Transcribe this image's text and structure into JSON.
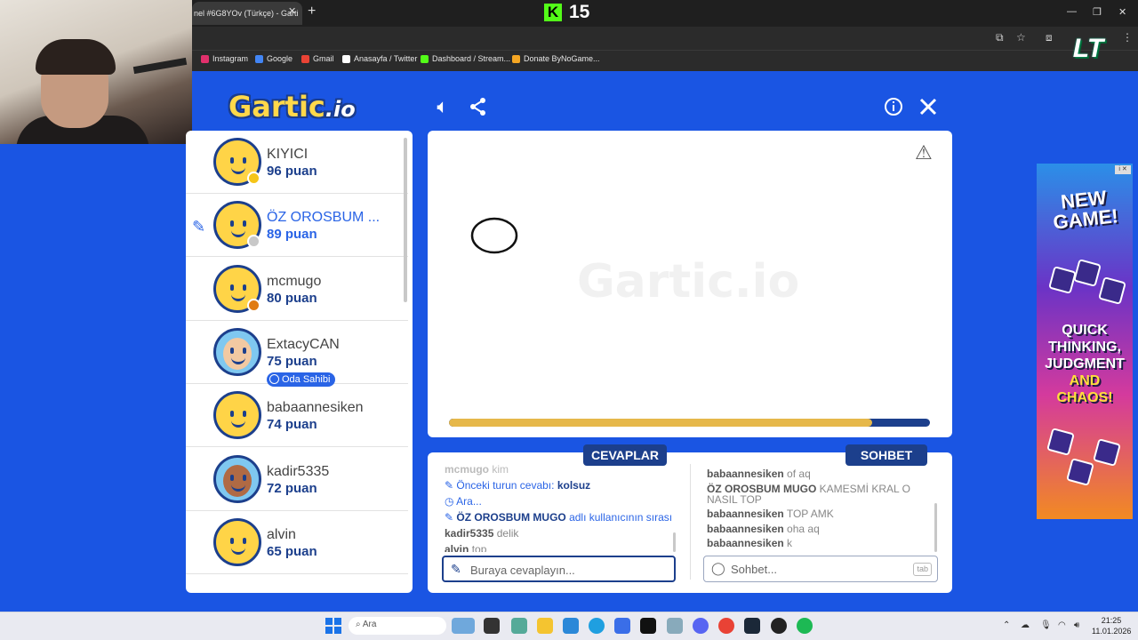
{
  "browser": {
    "tab_title": "nel #6G8YOv (Türkçe) - Garti",
    "tab_close": "✕",
    "new_tab": "+",
    "viewer_count": "15",
    "kick_letter": "K",
    "bookmarks": [
      {
        "label": "Instagram",
        "color": "#e1306c"
      },
      {
        "label": "Google",
        "color": "#4285f4"
      },
      {
        "label": "Gmail",
        "color": "#ea4335"
      },
      {
        "label": "Anasayfa / Twitter",
        "color": "#ffffff"
      },
      {
        "label": "Dashboard / Stream...",
        "color": "#53fc18"
      },
      {
        "label": "Donate ByNoGame...",
        "color": "#f5a623"
      }
    ],
    "overlay_logo": "LT"
  },
  "game": {
    "logo_main": "Gartic",
    "logo_suffix": ".io",
    "watermark_main": "Gartic",
    "watermark_suffix": ".io",
    "colors": {
      "background": "#1a55e3",
      "navy": "#1c3f8c",
      "accent": "#2a64e6",
      "timer": "#e6b84a"
    },
    "timer_remaining": 0.88,
    "players": [
      {
        "name": "KIYICI",
        "score": "96 puan",
        "status_color": "#f5c518",
        "active": false
      },
      {
        "name": "ÖZ OROSBUM ...",
        "score": "89 puan",
        "status_color": "#c8c8c8",
        "active": true
      },
      {
        "name": "mcmugo",
        "score": "80 puan",
        "status_color": "#e07b12",
        "active": false
      },
      {
        "name": "ExtacyCAN",
        "score": "75 puan",
        "badge": "Oda Sahibi",
        "active": false
      },
      {
        "name": "babaannesiken",
        "score": "74 puan",
        "active": false
      },
      {
        "name": "kadir5335",
        "score": "72 puan",
        "active": false
      },
      {
        "name": "alvin",
        "score": "65 puan",
        "active": false
      }
    ],
    "answers_tab": "CEVAPLAR",
    "chat_tab": "SOHBET",
    "answers_feed": {
      "faded_user": "mcmugo",
      "faded_msg": "kim",
      "prev_answer_label": "Önceki turun cevabı:",
      "prev_answer_value": "kolsuz",
      "search_msg": "Ara...",
      "turn_user": "ÖZ OROSBUM MUGO",
      "turn_msg": "adlı kullanıcının sırası",
      "guess1_user": "kadir5335",
      "guess1_msg": "delik",
      "guess2_user": "alvin",
      "guess2_msg": "top"
    },
    "chat_feed": [
      {
        "user": "babaannesiken",
        "msg": "of aq"
      },
      {
        "user": "ÖZ OROSBUM MUGO",
        "msg": "KAMESMİ KRAL O NASIL TOP"
      },
      {
        "user": "babaannesiken",
        "msg": "TOP AMK"
      },
      {
        "user": "babaannesiken",
        "msg": "oha aq"
      },
      {
        "user": "babaannesiken",
        "msg": "k"
      }
    ],
    "answer_placeholder": "Buraya cevaplayın...",
    "chat_placeholder": "Sohbet...",
    "tab_key": "tab"
  },
  "ad": {
    "headline": "NEW GAME!",
    "slogan_line1": "QUICK",
    "slogan_line2": "THINKING,",
    "slogan_line3": "JUDGMENT",
    "slogan_line4": "AND",
    "slogan_line5": "CHAOS!"
  },
  "taskbar": {
    "search_label": "Ara",
    "time": "21:25",
    "date": "11.01.2026"
  }
}
